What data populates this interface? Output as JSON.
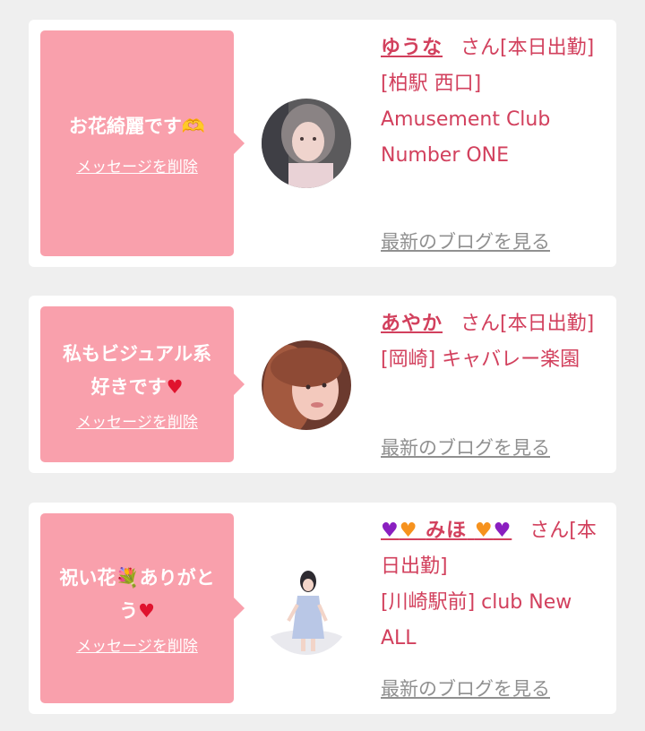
{
  "delete_label": "メッセージを削除",
  "blog_label": "最新のブログを見る",
  "colors": {
    "bubble": "#f9a0ac",
    "accent": "#d2405d",
    "link_gray": "#909090",
    "background": "#efefef"
  },
  "cards": [
    {
      "message": "お花綺麗です",
      "message_icon": "heart-hands-icon",
      "name": "ゆうな",
      "san": "さん[本日出勤]",
      "shop": "[柏駅 西口] Amusement Club Number ONE"
    },
    {
      "message_line1": "私もビジュアル系",
      "message_line2": "好きです",
      "message_icon": "red-heart-icon",
      "name": "あやか",
      "san": "さん[本日出勤]",
      "shop": "[岡崎] キャバレー楽園"
    },
    {
      "message_part1": "祝い花",
      "message_part2": "ありがと",
      "message_part3": "う",
      "message_icons": [
        "bouquet-icon",
        "red-heart-icon"
      ],
      "name": "みほ",
      "name_icons": [
        "purple-heart-icon",
        "orange-heart-icon",
        "orange-heart-icon",
        "purple-heart-icon"
      ],
      "san": "さん[本日出勤]",
      "shop": "[川崎駅前] club New ALL"
    }
  ]
}
